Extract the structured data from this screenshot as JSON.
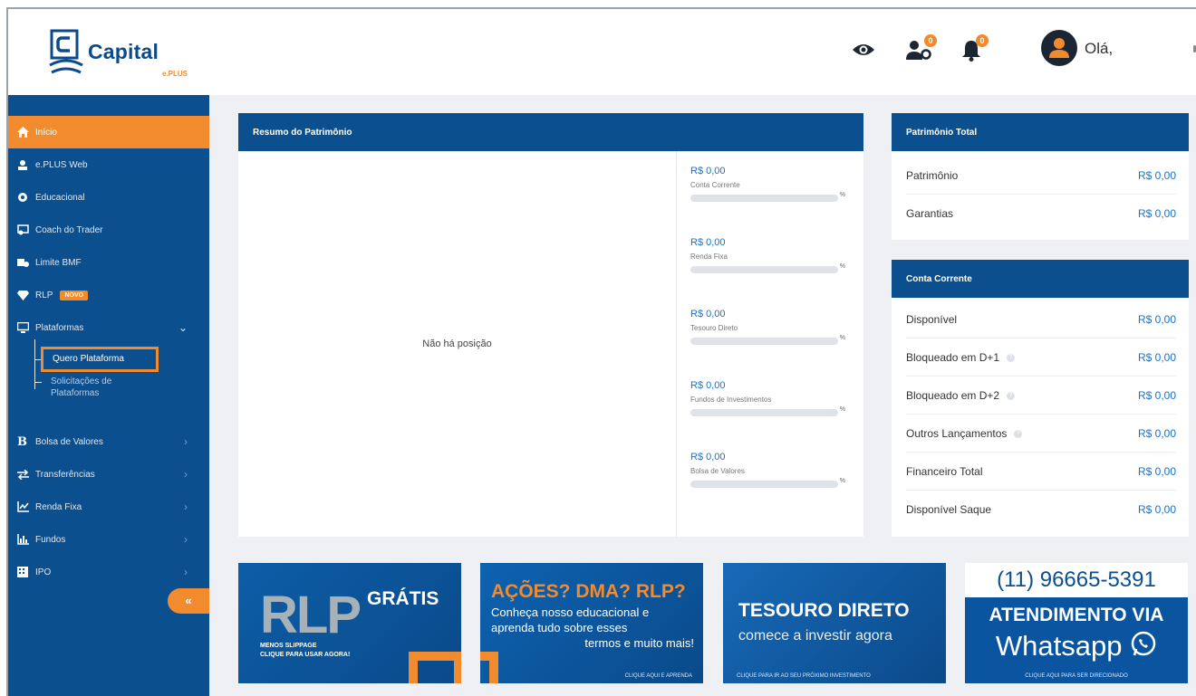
{
  "header": {
    "logo_text": "Capital",
    "logo_sub": "e.PLUS",
    "greeting": "Olá,",
    "badges": {
      "users": "0",
      "notifications": "0"
    }
  },
  "sidebar": {
    "items": [
      {
        "label": "Início",
        "icon": "home-icon",
        "active": true
      },
      {
        "label": "e.PLUS Web",
        "icon": "users-icon"
      },
      {
        "label": "Educacional",
        "icon": "graduation-icon"
      },
      {
        "label": "Coach do Trader",
        "icon": "coach-icon"
      },
      {
        "label": "Limite BMF",
        "icon": "limit-icon"
      },
      {
        "label": "RLP",
        "icon": "diamond-icon",
        "tag": "NOVO"
      },
      {
        "label": "Plataformas",
        "icon": "monitor-icon"
      },
      {
        "label": "Bolsa de Valores",
        "icon": "b-icon"
      },
      {
        "label": "Transferências",
        "icon": "transfer-icon"
      },
      {
        "label": "Renda Fixa",
        "icon": "chart-line-icon"
      },
      {
        "label": "Fundos",
        "icon": "chart-bar-icon"
      },
      {
        "label": "IPO",
        "icon": "building-icon"
      }
    ],
    "sub_items": {
      "quero": "Quero Plataforma",
      "solicitacoes_l1": "Solicitações de",
      "solicitacoes_l2": "Plataformas"
    },
    "collapse": "«"
  },
  "resumo": {
    "title": "Resumo do Patrimônio",
    "empty": "Não há posição",
    "items": [
      {
        "value": "R$ 0,00",
        "label": "Conta Corrente",
        "pct": "%"
      },
      {
        "value": "R$ 0,00",
        "label": "Renda Fixa",
        "pct": "%"
      },
      {
        "value": "R$ 0,00",
        "label": "Tesouro Direto",
        "pct": "%"
      },
      {
        "value": "R$ 0,00",
        "label": "Fundos de Investimentos",
        "pct": "%"
      },
      {
        "value": "R$ 0,00",
        "label": "Bolsa de Valores",
        "pct": "%"
      }
    ]
  },
  "patrimonio_total": {
    "title": "Patrimônio Total",
    "rows": [
      {
        "label": "Patrimônio",
        "value": "R$ 0,00"
      },
      {
        "label": "Garantias",
        "value": "R$ 0,00"
      }
    ]
  },
  "conta_corrente": {
    "title": "Conta Corrente",
    "rows": [
      {
        "label": "Disponível",
        "value": "R$ 0,00"
      },
      {
        "label": "Bloqueado em D+1",
        "value": "R$ 0,00"
      },
      {
        "label": "Bloqueado em D+2",
        "value": "R$ 0,00"
      },
      {
        "label": "Outros Lançamentos",
        "value": "R$ 0,00"
      },
      {
        "label": "Financeiro Total",
        "value": "R$ 0,00"
      },
      {
        "label": "Disponível Saque",
        "value": "R$ 0,00"
      }
    ],
    "help": "?"
  },
  "banners": {
    "rlp": {
      "big": "RLP",
      "title": "GRÁTIS",
      "line1": "MENOS SLIPPAGE",
      "line2": "CLIQUE PARA USAR AGORA!"
    },
    "dma": {
      "title": "AÇÕES? DMA? RLP?",
      "l1": "Conheça nosso educacional e",
      "l2": "aprenda tudo sobre esses",
      "l3": "termos e muito mais!",
      "cta": "CLIQUE AQUI E APRENDA"
    },
    "tesouro": {
      "title": "TESOURO DIRETO",
      "sub": "comece a investir agora",
      "cta": "CLIQUE PARA IR AO SEU PRÓXIMO INVESTIMENTO"
    },
    "whatsapp": {
      "phone": "(11) 96665-5391",
      "title": "ATENDIMENTO VIA",
      "brand": "Whatsapp",
      "cta": "CLIQUE AQUI PARA SER DIRECIONADO"
    }
  },
  "colors": {
    "primary": "#0b4f8e",
    "accent": "#f28a2e",
    "value": "#1a73c9"
  }
}
